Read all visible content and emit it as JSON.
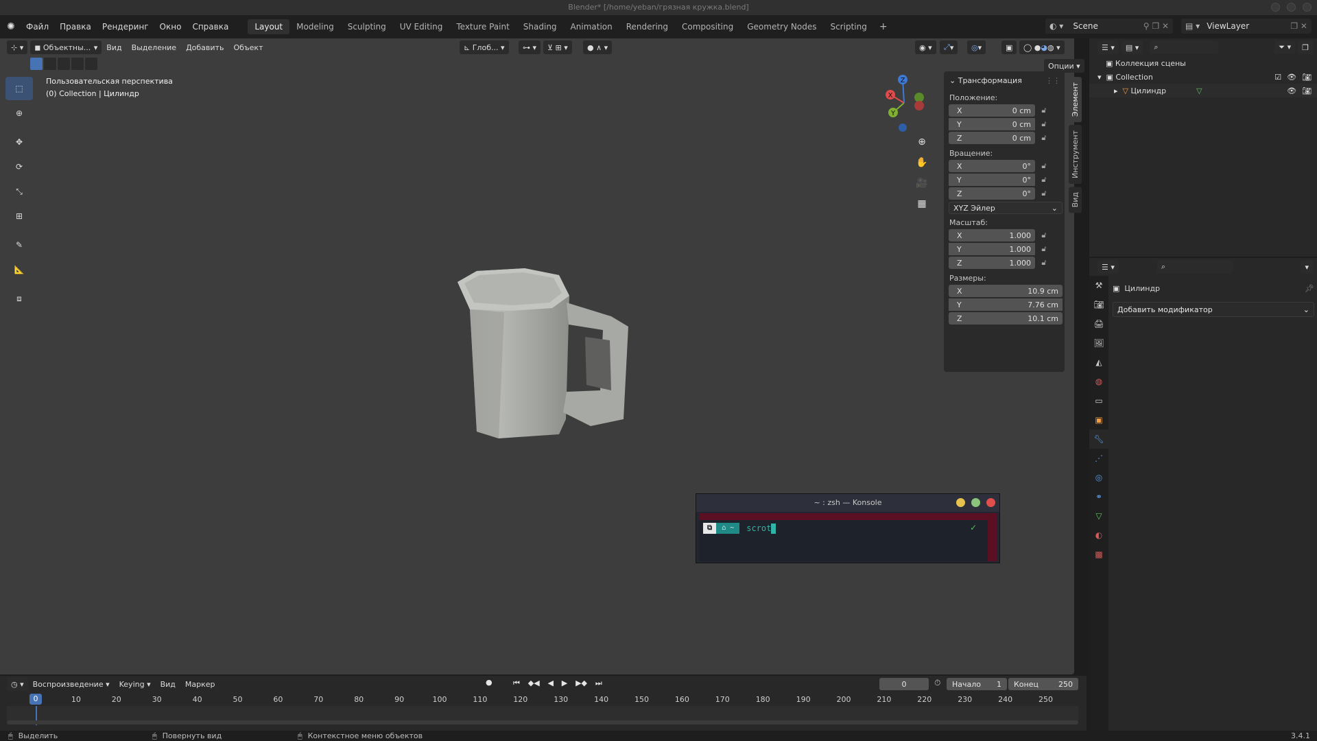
{
  "window": {
    "title": "Blender* [/home/yeban/грязная кружка.blend]"
  },
  "menu": {
    "items": [
      "Файл",
      "Правка",
      "Рендеринг",
      "Окно",
      "Справка"
    ]
  },
  "workspaces": {
    "tabs": [
      "Layout",
      "Modeling",
      "Sculpting",
      "UV Editing",
      "Texture Paint",
      "Shading",
      "Animation",
      "Rendering",
      "Compositing",
      "Geometry Nodes",
      "Scripting"
    ],
    "active": "Layout",
    "add_label": "+"
  },
  "scene": {
    "name": "Scene"
  },
  "view_layer": {
    "name": "ViewLayer"
  },
  "viewport": {
    "mode": "Объектны...",
    "menus": [
      "Вид",
      "Выделение",
      "Добавить",
      "Объект"
    ],
    "orientation": "Глоб...",
    "options_label": "Опции",
    "info_line1": "Пользовательская перспектива",
    "info_line2": "(0) Collection | Цилиндр",
    "gizmo": {
      "z": "Z",
      "y": "Y",
      "x": "X"
    }
  },
  "npanel": {
    "title": "Трансформация",
    "location_label": "Положение:",
    "location": [
      {
        "axis": "X",
        "value": "0 cm"
      },
      {
        "axis": "Y",
        "value": "0 cm"
      },
      {
        "axis": "Z",
        "value": "0 cm"
      }
    ],
    "rotation_label": "Вращение:",
    "rotation": [
      {
        "axis": "X",
        "value": "0°"
      },
      {
        "axis": "Y",
        "value": "0°"
      },
      {
        "axis": "Z",
        "value": "0°"
      }
    ],
    "rotation_mode": "XYZ Эйлер",
    "scale_label": "Масштаб:",
    "scale": [
      {
        "axis": "X",
        "value": "1.000"
      },
      {
        "axis": "Y",
        "value": "1.000"
      },
      {
        "axis": "Z",
        "value": "1.000"
      }
    ],
    "dimensions_label": "Размеры:",
    "dimensions": [
      {
        "axis": "X",
        "value": "10.9 cm"
      },
      {
        "axis": "Y",
        "value": "7.76 cm"
      },
      {
        "axis": "Z",
        "value": "10.1 cm"
      }
    ],
    "tabs": [
      "Элемент",
      "Инструмент",
      "Вид"
    ]
  },
  "konsole": {
    "title": "~ : zsh — Konsole",
    "prompt_seg2": "~",
    "command": "scrot",
    "check": "✓"
  },
  "outliner": {
    "scene_collection": "Коллекция сцены",
    "collection": "Collection",
    "object": "Цилиндр"
  },
  "properties": {
    "object_name": "Цилиндр",
    "add_modifier": "Добавить модификатор"
  },
  "timeline": {
    "playback_label": "Воспроизведение",
    "keying_label": "Keying",
    "view_label": "Вид",
    "marker_label": "Маркер",
    "current_frame": "0",
    "start_label": "Начало",
    "start_value": "1",
    "end_label": "Конец",
    "end_value": "250",
    "ruler": [
      "0",
      "10",
      "20",
      "30",
      "40",
      "50",
      "60",
      "70",
      "80",
      "90",
      "100",
      "110",
      "120",
      "130",
      "140",
      "150",
      "160",
      "170",
      "180",
      "190",
      "200",
      "210",
      "220",
      "230",
      "240",
      "250"
    ]
  },
  "statusbar": {
    "select": "Выделить",
    "rotate": "Повернуть вид",
    "context": "Контекстное меню объектов",
    "version": "3.4.1"
  },
  "colors": {
    "accent": "#4772b3",
    "viewport_bg": "#3d3d3d",
    "panel_bg": "#282828",
    "axis_x": "#e14b4b",
    "axis_y": "#7fb02f",
    "axis_z": "#3d7ad8"
  }
}
